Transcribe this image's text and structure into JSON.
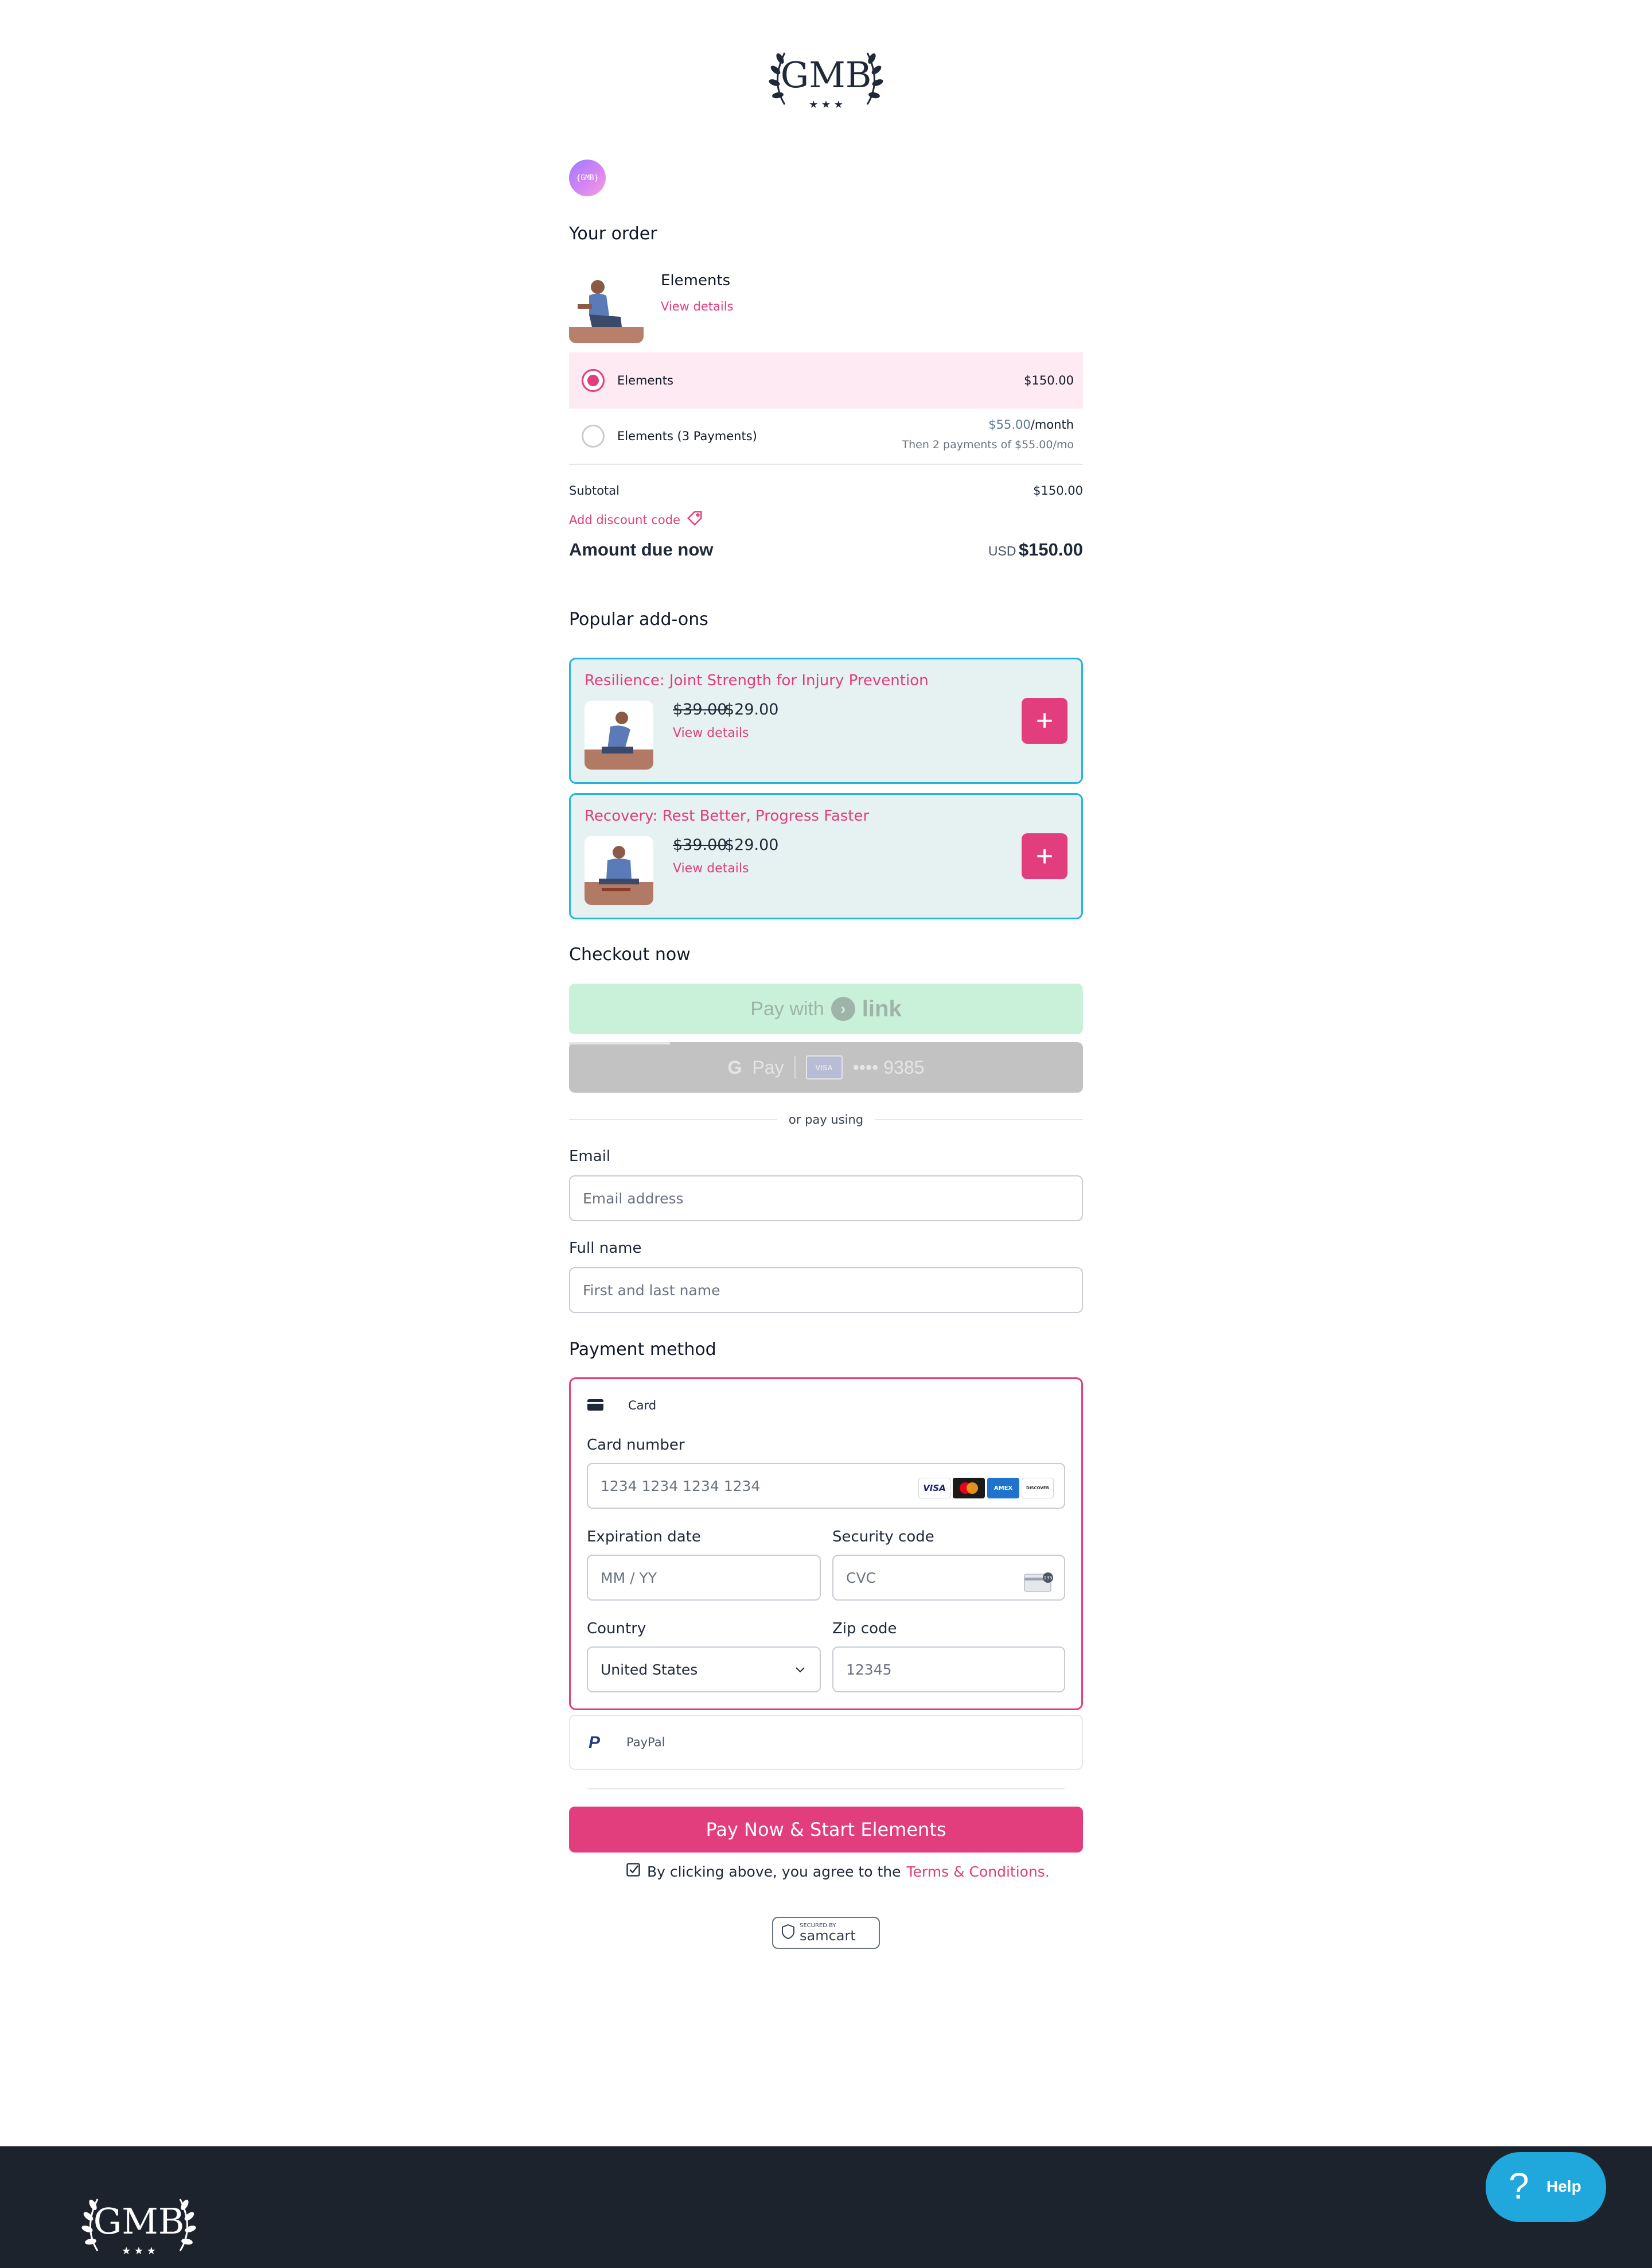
{
  "header": {
    "logo_text": "GMB",
    "avatar_text": "{GMB}"
  },
  "order": {
    "heading": "Your order",
    "product_name": "Elements",
    "view_details": "View details",
    "options": [
      {
        "label": "Elements",
        "price": "$150.00",
        "selected": true
      },
      {
        "label": "Elements (3 Payments)",
        "price_amount": "$55.00",
        "price_period": "/month",
        "sub": "Then 2 payments of $55.00/mo",
        "selected": false
      }
    ],
    "subtotal_label": "Subtotal",
    "subtotal_value": "$150.00",
    "discount_label": "Add discount code",
    "amount_due_label": "Amount due now",
    "currency": "USD",
    "amount_due_value": "$150.00"
  },
  "addons": {
    "heading": "Popular add-ons",
    "items": [
      {
        "title": "Resilience: Joint Strength for Injury Prevention",
        "was": "$39.00",
        "now": "$29.00",
        "view_details": "View details"
      },
      {
        "title": "Recovery: Rest Better, Progress Faster",
        "was": "$39.00",
        "now": "$29.00",
        "view_details": "View details"
      }
    ]
  },
  "checkout": {
    "heading": "Checkout now",
    "link_prefix": "Pay with",
    "link_word": "link",
    "gpay_text": "Pay",
    "card_brand": "VISA",
    "card_digits": "•••• 9385",
    "divider": "or pay using"
  },
  "form": {
    "email_label": "Email",
    "email_placeholder": "Email address",
    "name_label": "Full name",
    "name_placeholder": "First and last name"
  },
  "payment": {
    "heading": "Payment method",
    "card_tab": "Card",
    "card_number_label": "Card number",
    "card_number_placeholder": "1234 1234 1234 1234",
    "brands": [
      "VISA",
      "MC",
      "AMEX",
      "DISCOVER"
    ],
    "expiry_label": "Expiration date",
    "expiry_placeholder": "MM / YY",
    "cvc_label": "Security code",
    "cvc_placeholder": "CVC",
    "country_label": "Country",
    "country_value": "United States",
    "zip_label": "Zip code",
    "zip_placeholder": "12345",
    "paypal_label": "PayPal"
  },
  "submit": {
    "button": "Pay Now & Start Elements",
    "agree_prefix": "By clicking above, you agree to the",
    "terms": "Terms & Conditions.",
    "badge_top": "SECURED BY",
    "badge_brand": "samcart"
  },
  "footer": {
    "help": "Help",
    "logo_text": "GMB"
  },
  "colors": {
    "accent": "#e23d7c",
    "addon_border": "#28b3d8",
    "footer_bg": "#1d232d",
    "help_bg": "#20a8dd",
    "link_bg": "#c9f0d8"
  }
}
